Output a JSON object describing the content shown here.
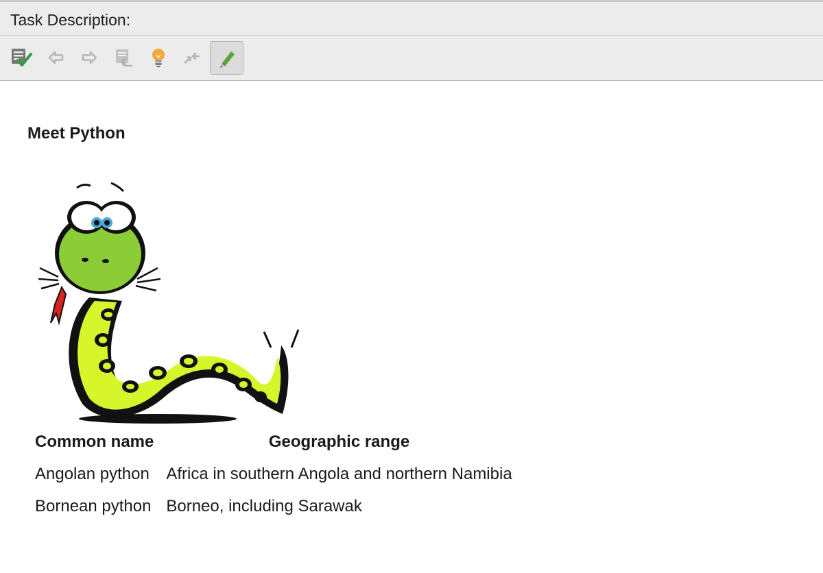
{
  "panel": {
    "title": "Task Description:"
  },
  "toolbar": {
    "buttons": [
      {
        "name": "check-task-icon",
        "enabled": true
      },
      {
        "name": "previous-task-icon",
        "enabled": false
      },
      {
        "name": "next-task-icon",
        "enabled": false
      },
      {
        "name": "reset-task-icon",
        "enabled": false
      },
      {
        "name": "hint-icon",
        "enabled": true
      },
      {
        "name": "compare-icon",
        "enabled": false
      },
      {
        "name": "edit-icon",
        "enabled": true,
        "active": true
      }
    ]
  },
  "content": {
    "heading": "Meet Python",
    "table": {
      "headers": [
        "Common name",
        "Geographic range"
      ],
      "rows": [
        [
          "Angolan python",
          "Africa in southern Angola and northern Namibia"
        ],
        [
          "Bornean python",
          "Borneo, including Sarawak"
        ]
      ]
    }
  },
  "colors": {
    "toolbar_bg": "#ececec",
    "check_green": "#2e9e3a",
    "bulb_orange": "#f2a93b",
    "pencil_green": "#5aa63c",
    "snake_body": "#d6f52a",
    "snake_head": "#8ccd37"
  }
}
